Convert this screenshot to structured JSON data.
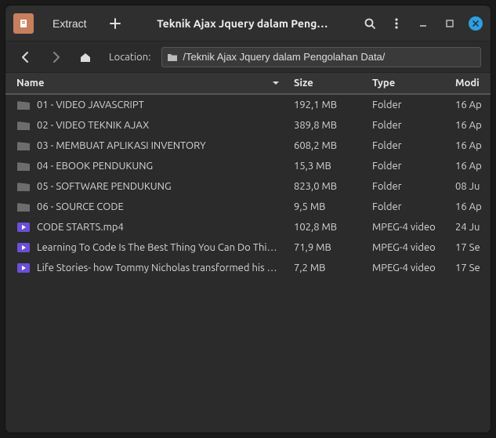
{
  "titlebar": {
    "extract_label": "Extract",
    "title": "Teknik Ajax Jquery dalam Peng…"
  },
  "nav": {
    "location_label": "Location:",
    "location_value": "/Teknik Ajax Jquery dalam Pengolahan Data/"
  },
  "columns": {
    "name": "Name",
    "size": "Size",
    "type": "Type",
    "modified": "Modi"
  },
  "rows": [
    {
      "kind": "folder",
      "name": "01 - VIDEO JAVASCRIPT",
      "size": "192,1 MB",
      "type": "Folder",
      "mod": "16 Ap"
    },
    {
      "kind": "folder",
      "name": "02 - VIDEO TEKNIK AJAX",
      "size": "389,8 MB",
      "type": "Folder",
      "mod": "16 Ap"
    },
    {
      "kind": "folder",
      "name": "03 - MEMBUAT APLIKASI INVENTORY",
      "size": "608,2 MB",
      "type": "Folder",
      "mod": "16 Ap"
    },
    {
      "kind": "folder",
      "name": "04 - EBOOK PENDUKUNG",
      "size": "15,3 MB",
      "type": "Folder",
      "mod": "16 Ap"
    },
    {
      "kind": "folder",
      "name": "05 - SOFTWARE PENDUKUNG",
      "size": "823,0 MB",
      "type": "Folder",
      "mod": "08 Ju"
    },
    {
      "kind": "folder",
      "name": "06 - SOURCE CODE",
      "size": "9,5 MB",
      "type": "Folder",
      "mod": "16 Ap"
    },
    {
      "kind": "video",
      "name": "CODE STARTS.mp4",
      "size": "102,8 MB",
      "type": "MPEG-4 video",
      "mod": "24 Ju"
    },
    {
      "kind": "video",
      "name": "Learning To Code Is The Best Thing You Can Do This …",
      "size": "71,9 MB",
      "type": "MPEG-4 video",
      "mod": "17 Se"
    },
    {
      "kind": "video",
      "name": "Life Stories- how Tommy Nicholas transformed his ca…",
      "size": "7,2 MB",
      "type": "MPEG-4 video",
      "mod": "17 Se"
    }
  ]
}
